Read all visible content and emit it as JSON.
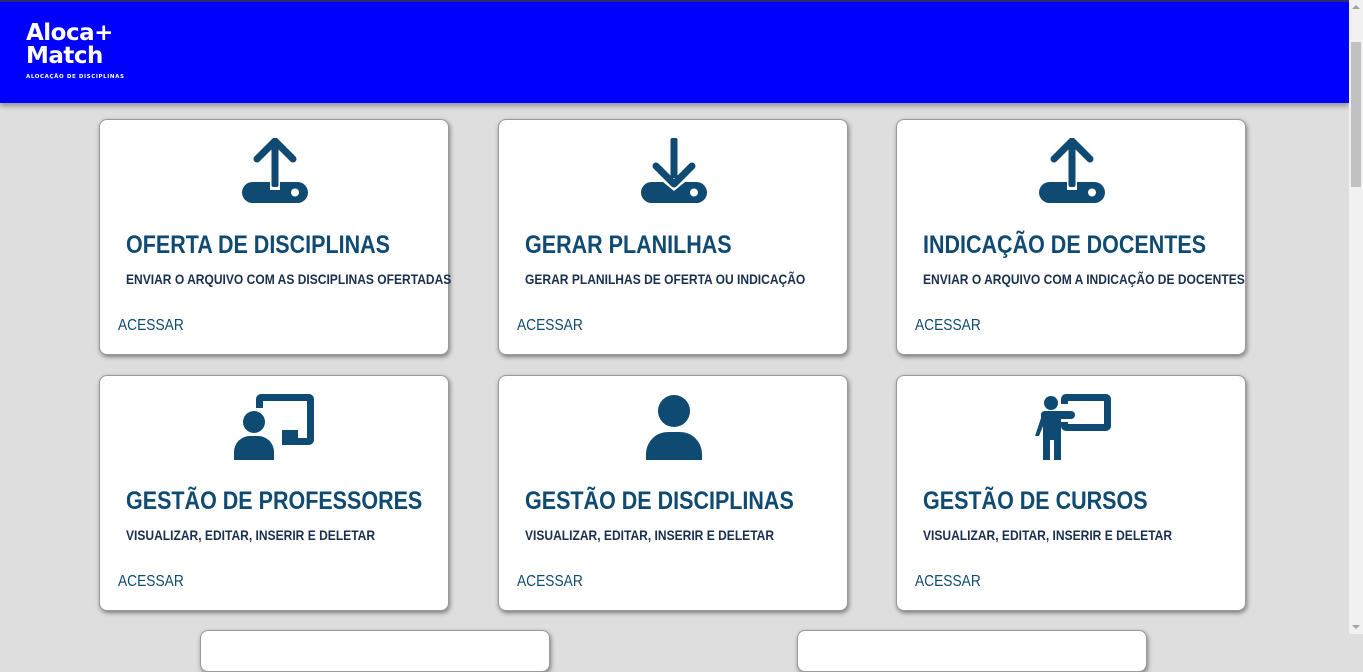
{
  "header": {
    "logo_line1": "Aloca+",
    "logo_line2": "Match",
    "logo_subtitle": "ALOCAÇÃO DE DISCIPLINAS",
    "background_color": "#0000ff"
  },
  "theme": {
    "accent": "#0f4a72",
    "page_background": "#dedede"
  },
  "cards": [
    {
      "icon": "upload-icon",
      "title": "OFERTA DE DISCIPLINAS",
      "description": "ENVIAR O ARQUIVO COM AS DISCIPLINAS OFERTADAS",
      "link": "ACESSAR"
    },
    {
      "icon": "download-icon",
      "title": "GERAR PLANILHAS",
      "description": "GERAR PLANILHAS DE OFERTA OU INDICAÇÃO",
      "link": "ACESSAR"
    },
    {
      "icon": "upload-icon",
      "title": "INDICAÇÃO DE DOCENTES",
      "description": "ENVIAR O ARQUIVO COM A INDICAÇÃO DE DOCENTES",
      "link": "ACESSAR"
    },
    {
      "icon": "chalkboard-user-icon",
      "title": "GESTÃO DE PROFESSORES",
      "description": "VISUALIZAR, EDITAR, INSERIR E DELETAR",
      "link": "ACESSAR"
    },
    {
      "icon": "user-icon",
      "title": "GESTÃO DE DISCIPLINAS",
      "description": "VISUALIZAR, EDITAR, INSERIR E DELETAR",
      "link": "ACESSAR"
    },
    {
      "icon": "teacher-board-icon",
      "title": "GESTÃO DE CURSOS",
      "description": "VISUALIZAR, EDITAR, INSERIR E DELETAR",
      "link": "ACESSAR"
    }
  ]
}
